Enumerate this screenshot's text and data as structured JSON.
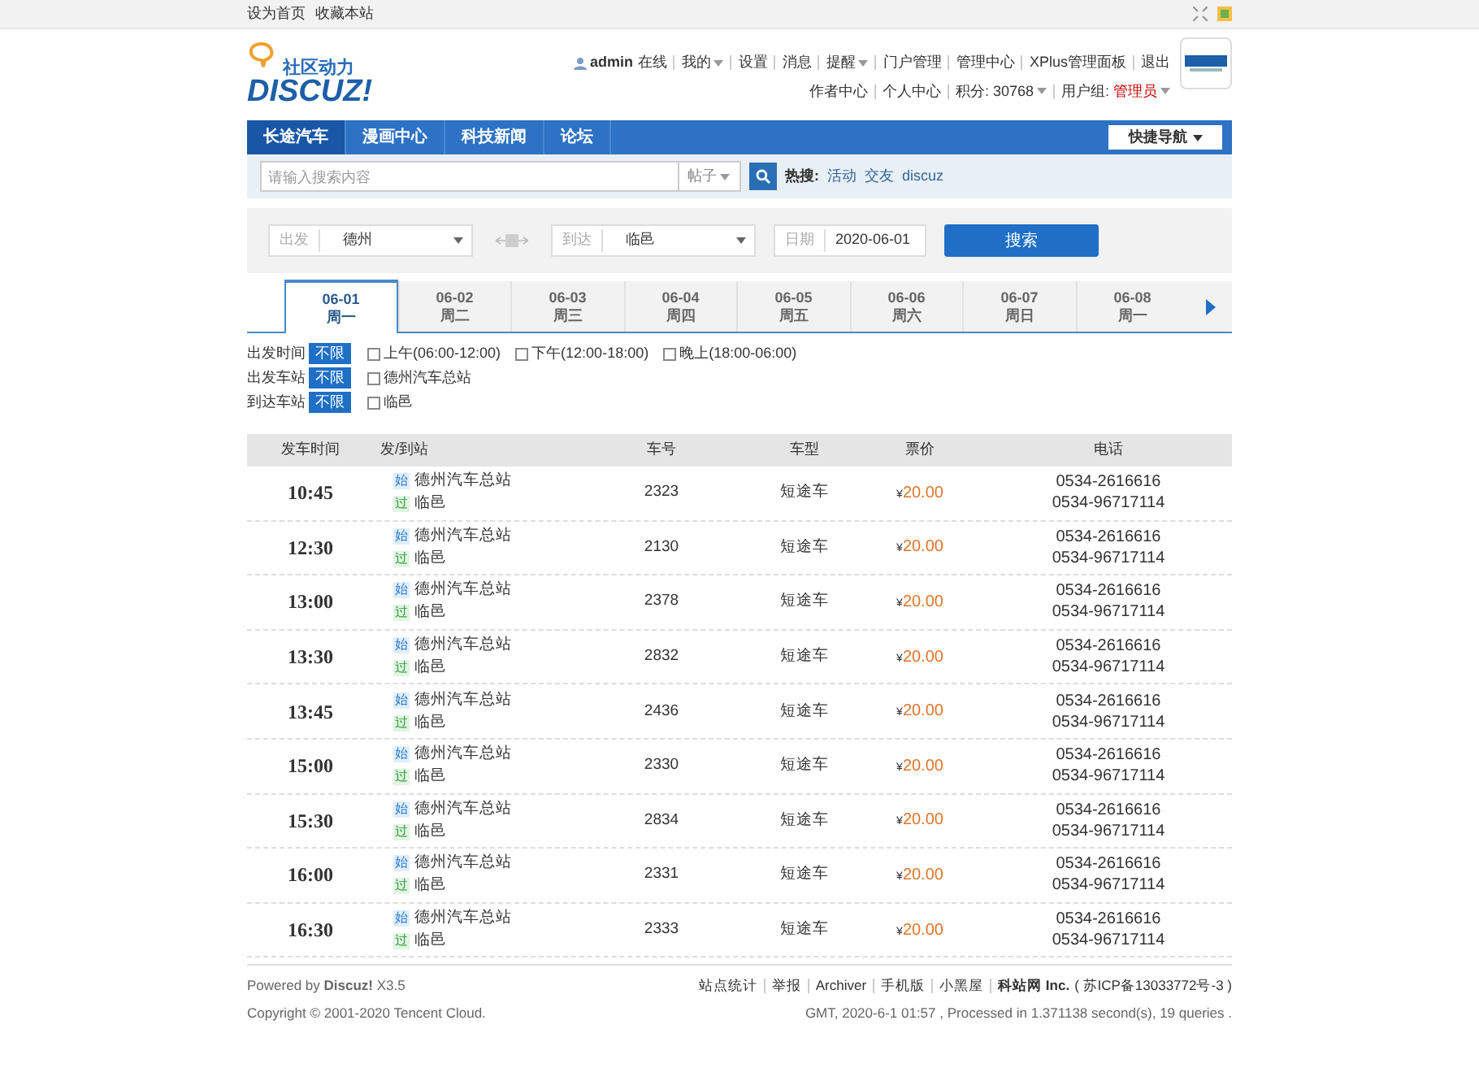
{
  "topbar": {
    "links": [
      "设为首页",
      "收藏本站"
    ]
  },
  "logo": {
    "tagline": "社区动力",
    "wordmark": "DISCUZ!"
  },
  "user_menu": {
    "row1": [
      {
        "text": "admin",
        "bold": true,
        "user_icon": true
      },
      {
        "text": "在线"
      },
      {
        "text": "我的",
        "caret": true
      },
      {
        "text": "设置"
      },
      {
        "text": "消息"
      },
      {
        "text": "提醒",
        "caret": true
      },
      {
        "text": "门户管理"
      },
      {
        "text": "管理中心"
      },
      {
        "text": "XPlus管理面板"
      },
      {
        "text": "退出"
      }
    ],
    "row2": [
      {
        "text": "作者中心"
      },
      {
        "text": "个人中心"
      },
      {
        "text": "积分: 30768",
        "caret": true
      },
      {
        "text": "用户组: ",
        "highlight": "管理员",
        "caret": true
      }
    ]
  },
  "nav": {
    "items": [
      {
        "label": "长途汽车",
        "selected": true
      },
      {
        "label": "漫画中心",
        "selected": false
      },
      {
        "label": "科技新闻",
        "selected": false
      },
      {
        "label": "论坛",
        "selected": false
      }
    ],
    "quick_nav": "快捷导航"
  },
  "search": {
    "placeholder": "请输入搜索内容",
    "type": "帖子",
    "hot_label": "热搜:",
    "hot": [
      "活动",
      "交友",
      "discuz"
    ]
  },
  "trip_form": {
    "from_label": "出发",
    "from": "德州",
    "to_label": "到达",
    "to": "临邑",
    "date_label": "日期",
    "date": "2020-06-01",
    "button": "搜索"
  },
  "dates": [
    {
      "date": "06-01",
      "weekday": "周一",
      "selected": true
    },
    {
      "date": "06-02",
      "weekday": "周二",
      "selected": false
    },
    {
      "date": "06-03",
      "weekday": "周三",
      "selected": false
    },
    {
      "date": "06-04",
      "weekday": "周四",
      "selected": false
    },
    {
      "date": "06-05",
      "weekday": "周五",
      "selected": false
    },
    {
      "date": "06-06",
      "weekday": "周六",
      "selected": false
    },
    {
      "date": "06-07",
      "weekday": "周日",
      "selected": false
    },
    {
      "date": "06-08",
      "weekday": "周一",
      "selected": false
    }
  ],
  "filters": [
    {
      "label": "出发时间",
      "any": "不限",
      "any_selected": true,
      "options": [
        {
          "label": "上午(06:00-12:00)",
          "checked": false
        },
        {
          "label": "下午(12:00-18:00)",
          "checked": false
        },
        {
          "label": "晚上(18:00-06:00)",
          "checked": false
        }
      ]
    },
    {
      "label": "出发车站",
      "any": "不限",
      "any_selected": true,
      "options": [
        {
          "label": "德州汽车总站",
          "checked": false
        }
      ]
    },
    {
      "label": "到达车站",
      "any": "不限",
      "any_selected": true,
      "options": [
        {
          "label": "临邑",
          "checked": false
        }
      ]
    }
  ],
  "table": {
    "columns": [
      "发车时间",
      "发/到站",
      "车号",
      "车型",
      "票价",
      "电话"
    ],
    "rows": [
      {
        "time": "10:45",
        "from_tag": "始",
        "from": "德州汽车总站",
        "to_tag": "过",
        "to": "临邑",
        "bus_no": "2323",
        "type": "短途车",
        "currency": "¥",
        "price": "20.00",
        "phones": [
          "0534-2616616",
          "0534-96717114"
        ]
      },
      {
        "time": "12:30",
        "from_tag": "始",
        "from": "德州汽车总站",
        "to_tag": "过",
        "to": "临邑",
        "bus_no": "2130",
        "type": "短途车",
        "currency": "¥",
        "price": "20.00",
        "phones": [
          "0534-2616616",
          "0534-96717114"
        ]
      },
      {
        "time": "13:00",
        "from_tag": "始",
        "from": "德州汽车总站",
        "to_tag": "过",
        "to": "临邑",
        "bus_no": "2378",
        "type": "短途车",
        "currency": "¥",
        "price": "20.00",
        "phones": [
          "0534-2616616",
          "0534-96717114"
        ]
      },
      {
        "time": "13:30",
        "from_tag": "始",
        "from": "德州汽车总站",
        "to_tag": "过",
        "to": "临邑",
        "bus_no": "2832",
        "type": "短途车",
        "currency": "¥",
        "price": "20.00",
        "phones": [
          "0534-2616616",
          "0534-96717114"
        ]
      },
      {
        "time": "13:45",
        "from_tag": "始",
        "from": "德州汽车总站",
        "to_tag": "过",
        "to": "临邑",
        "bus_no": "2436",
        "type": "短途车",
        "currency": "¥",
        "price": "20.00",
        "phones": [
          "0534-2616616",
          "0534-96717114"
        ]
      },
      {
        "time": "15:00",
        "from_tag": "始",
        "from": "德州汽车总站",
        "to_tag": "过",
        "to": "临邑",
        "bus_no": "2330",
        "type": "短途车",
        "currency": "¥",
        "price": "20.00",
        "phones": [
          "0534-2616616",
          "0534-96717114"
        ]
      },
      {
        "time": "15:30",
        "from_tag": "始",
        "from": "德州汽车总站",
        "to_tag": "过",
        "to": "临邑",
        "bus_no": "2834",
        "type": "短途车",
        "currency": "¥",
        "price": "20.00",
        "phones": [
          "0534-2616616",
          "0534-96717114"
        ]
      },
      {
        "time": "16:00",
        "from_tag": "始",
        "from": "德州汽车总站",
        "to_tag": "过",
        "to": "临邑",
        "bus_no": "2331",
        "type": "短途车",
        "currency": "¥",
        "price": "20.00",
        "phones": [
          "0534-2616616",
          "0534-96717114"
        ]
      },
      {
        "time": "16:30",
        "from_tag": "始",
        "from": "德州汽车总站",
        "to_tag": "过",
        "to": "临邑",
        "bus_no": "2333",
        "type": "短途车",
        "currency": "¥",
        "price": "20.00",
        "phones": [
          "0534-2616616",
          "0534-96717114"
        ]
      }
    ]
  },
  "footer": {
    "powered": "Powered by **Discuz!** X3.5",
    "copyright": "Copyright © 2001-2020 Tencent Cloud.",
    "links": [
      "站点统计",
      "举报",
      "Archiver",
      "手机版",
      "小黑屋"
    ],
    "company": "科站网 Inc.",
    "icp": "( 苏ICP备13033772号-3 )",
    "stats": "GMT, 2020-6-1 01:57 , Processed in 1.371138 second(s), 19 queries ."
  }
}
